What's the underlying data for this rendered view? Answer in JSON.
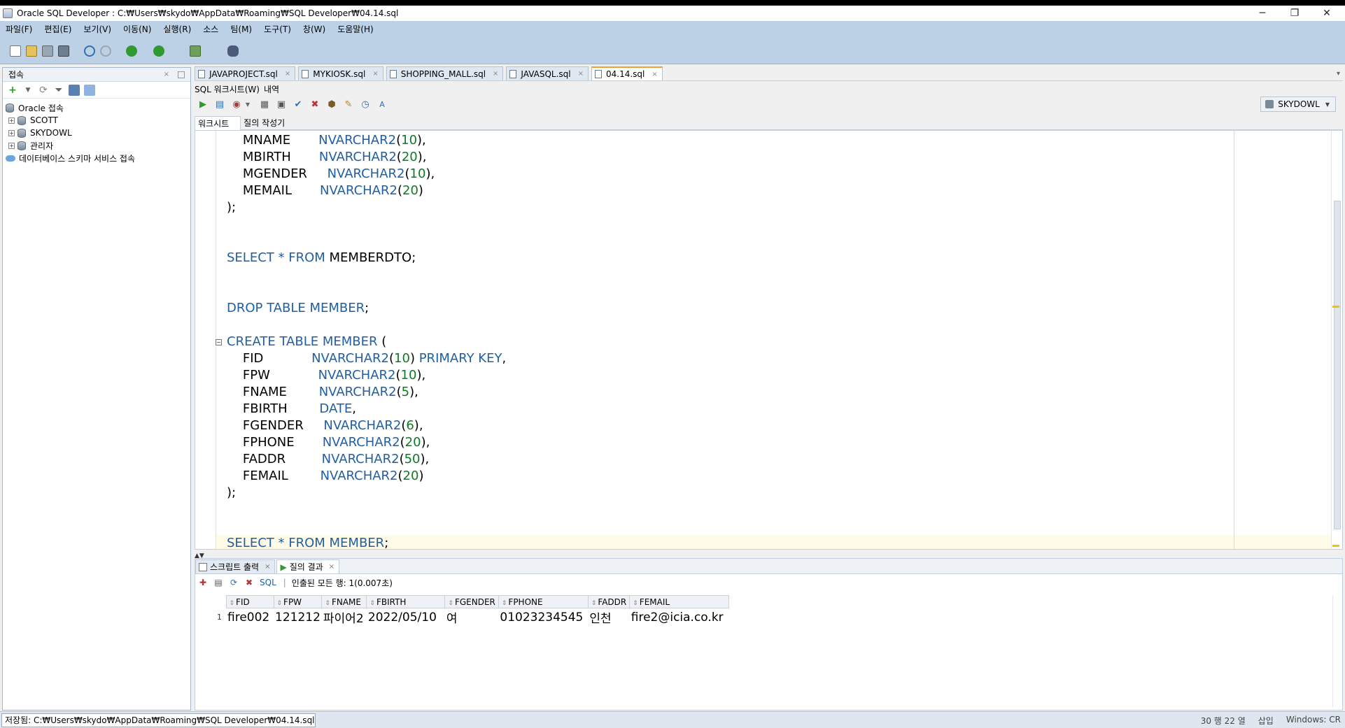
{
  "window": {
    "title": "Oracle SQL Developer : C:₩Users₩skydo₩AppData₩Roaming₩SQL Developer₩04.14.sql",
    "minimize": "─",
    "restore": "❐",
    "close": "✕"
  },
  "menu": [
    "파일(F)",
    "편집(E)",
    "보기(V)",
    "이동(N)",
    "실행(R)",
    "소스",
    "팀(M)",
    "도구(T)",
    "창(W)",
    "도움말(H)"
  ],
  "connections_panel": {
    "title": "접속",
    "close": "×",
    "tree": [
      {
        "label": "Oracle 접속",
        "type": "root"
      },
      {
        "label": "SCOTT",
        "type": "db"
      },
      {
        "label": "SKYDOWL",
        "type": "db"
      },
      {
        "label": "관리자",
        "type": "db"
      },
      {
        "label": "데이터베이스 스키마 서비스 접속",
        "type": "cloud"
      }
    ]
  },
  "doc_tabs": [
    "JAVAPROJECT.sql",
    "MYKIOSK.sql",
    "SHOPPING_MALL.sql",
    "JAVASQL.sql",
    "04.14.sql"
  ],
  "doc_tab_close": "×",
  "sub_tabs": [
    "SQL 워크시트(W)",
    "내역"
  ],
  "connection": "SKYDOWL",
  "worksheet_tabs": [
    "워크시트",
    "질의 작성기"
  ],
  "code": {
    "lines": [
      {
        "y": 0,
        "parts": [
          [
            "",
            "    MNAME       "
          ],
          [
            "kw",
            "NVARCHAR2"
          ],
          [
            "",
            "("
          ],
          [
            "nm",
            "10"
          ],
          [
            "",
            "),"
          ]
        ]
      },
      {
        "y": 1,
        "parts": [
          [
            "",
            "    MBIRTH       "
          ],
          [
            "kw",
            "NVARCHAR2"
          ],
          [
            "",
            "("
          ],
          [
            "nm",
            "20"
          ],
          [
            "",
            "),"
          ]
        ]
      },
      {
        "y": 2,
        "parts": [
          [
            "",
            "    MGENDER     "
          ],
          [
            "kw",
            "NVARCHAR2"
          ],
          [
            "",
            "("
          ],
          [
            "nm",
            "10"
          ],
          [
            "",
            "),"
          ]
        ]
      },
      {
        "y": 3,
        "parts": [
          [
            "",
            "    MEMAIL       "
          ],
          [
            "kw",
            "NVARCHAR2"
          ],
          [
            "",
            "("
          ],
          [
            "nm",
            "20"
          ],
          [
            "",
            ")"
          ]
        ]
      },
      {
        "y": 4,
        "parts": [
          [
            "",
            ");"
          ]
        ]
      },
      {
        "y": 7,
        "parts": [
          [
            "kw",
            "SELECT"
          ],
          [
            "",
            " "
          ],
          [
            "kw",
            "*"
          ],
          [
            "",
            " "
          ],
          [
            "kw",
            "FROM"
          ],
          [
            "",
            " MEMBERDTO;"
          ]
        ]
      },
      {
        "y": 10,
        "parts": [
          [
            "kw",
            "DROP TABLE MEMBER"
          ],
          [
            "",
            ";"
          ]
        ]
      },
      {
        "y": 12,
        "parts": [
          [
            "kw",
            "CREATE TABLE MEMBER"
          ],
          [
            "",
            " ("
          ]
        ]
      },
      {
        "y": 13,
        "parts": [
          [
            "",
            "    FID            "
          ],
          [
            "kw",
            "NVARCHAR2"
          ],
          [
            "",
            "("
          ],
          [
            "nm",
            "10"
          ],
          [
            "",
            ") "
          ],
          [
            "kw",
            "PRIMARY KEY"
          ],
          [
            "",
            ","
          ]
        ]
      },
      {
        "y": 14,
        "parts": [
          [
            "",
            "    FPW            "
          ],
          [
            "kw",
            "NVARCHAR2"
          ],
          [
            "",
            "("
          ],
          [
            "nm",
            "10"
          ],
          [
            "",
            "),"
          ]
        ]
      },
      {
        "y": 15,
        "parts": [
          [
            "",
            "    FNAME        "
          ],
          [
            "kw",
            "NVARCHAR2"
          ],
          [
            "",
            "("
          ],
          [
            "nm",
            "5"
          ],
          [
            "",
            "),"
          ]
        ]
      },
      {
        "y": 16,
        "parts": [
          [
            "",
            "    FBIRTH        "
          ],
          [
            "kw",
            "DATE"
          ],
          [
            "",
            ","
          ]
        ]
      },
      {
        "y": 17,
        "parts": [
          [
            "",
            "    FGENDER     "
          ],
          [
            "kw",
            "NVARCHAR2"
          ],
          [
            "",
            "("
          ],
          [
            "nm",
            "6"
          ],
          [
            "",
            "),"
          ]
        ]
      },
      {
        "y": 18,
        "parts": [
          [
            "",
            "    FPHONE       "
          ],
          [
            "kw",
            "NVARCHAR2"
          ],
          [
            "",
            "("
          ],
          [
            "nm",
            "20"
          ],
          [
            "",
            "),"
          ]
        ]
      },
      {
        "y": 19,
        "parts": [
          [
            "",
            "    FADDR         "
          ],
          [
            "kw",
            "NVARCHAR2"
          ],
          [
            "",
            "("
          ],
          [
            "nm",
            "50"
          ],
          [
            "",
            "),"
          ]
        ]
      },
      {
        "y": 20,
        "parts": [
          [
            "",
            "    FEMAIL        "
          ],
          [
            "kw",
            "NVARCHAR2"
          ],
          [
            "",
            "("
          ],
          [
            "nm",
            "20"
          ],
          [
            "",
            ")"
          ]
        ]
      },
      {
        "y": 21,
        "parts": [
          [
            "",
            ");"
          ]
        ]
      },
      {
        "y": 24,
        "parts": [
          [
            "kw",
            "SELECT"
          ],
          [
            "",
            " "
          ],
          [
            "kw",
            "*"
          ],
          [
            "",
            " "
          ],
          [
            "kw",
            "FROM MEMBER"
          ],
          [
            "",
            ";"
          ]
        ]
      }
    ]
  },
  "results": {
    "tabs": [
      "스크립트 출력",
      "질의 결과"
    ],
    "close": "×",
    "sql_label": "SQL",
    "fetch_info": "인출된 모든 행: 1(0.007초)",
    "columns": [
      "FID",
      "FPW",
      "FNAME",
      "FBIRTH",
      "FGENDER",
      "FPHONE",
      "FADDR",
      "FEMAIL"
    ],
    "rows": [
      {
        "num": "1",
        "cells": [
          "fire002",
          "121212",
          "파이어2",
          "2022/05/10",
          "여",
          "01023234545",
          "인천",
          "fire2@icia.co.kr"
        ]
      }
    ]
  },
  "status": {
    "path": "저장됨: C:₩Users₩skydo₩AppData₩Roaming₩SQL Developer₩04.14.sql",
    "position": "30 행 22 열",
    "mode": "삽입",
    "eol": "Windows: CR"
  }
}
